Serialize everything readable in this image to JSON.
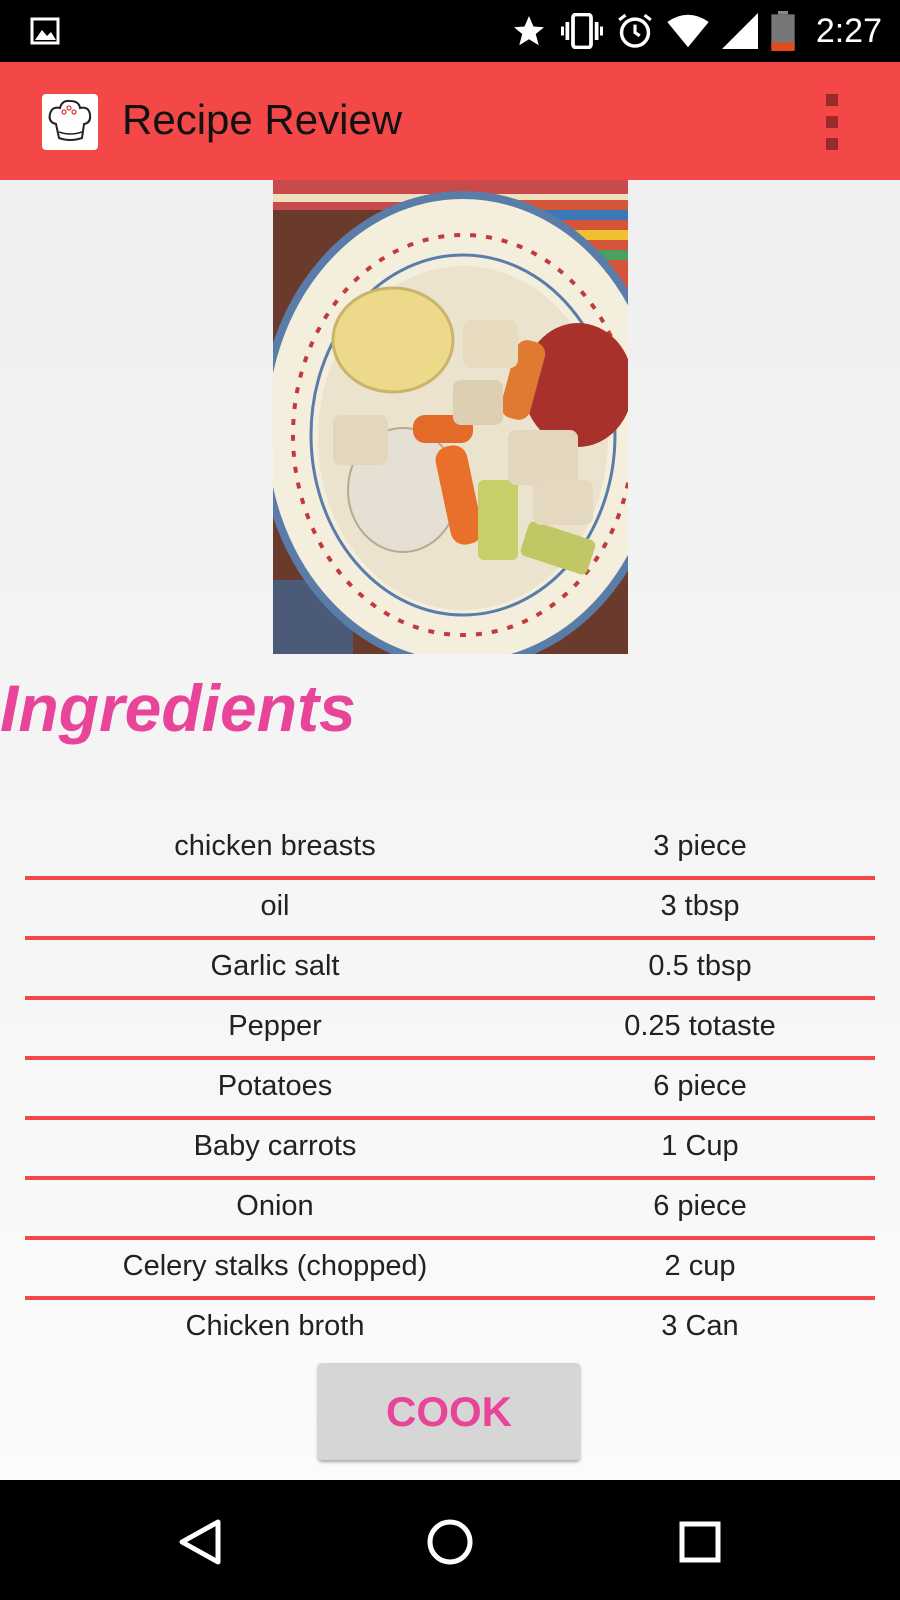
{
  "status_bar": {
    "time": "2:27",
    "icons": [
      "image-notification-icon",
      "star-icon",
      "vibrate-icon",
      "alarm-icon",
      "wifi-icon",
      "cell-signal-icon",
      "battery-low-icon"
    ]
  },
  "app_bar": {
    "title": "Recipe Review",
    "logo_icon": "chef-hat-icon",
    "menu_icon": "overflow-menu-icon"
  },
  "recipe": {
    "image_alt": "chicken stew with potatoes, carrots, onion and celery"
  },
  "ingredients_section": {
    "title": "Ingredients",
    "items": [
      {
        "name": "chicken breasts",
        "quantity": "3 piece"
      },
      {
        "name": "oil",
        "quantity": "3 tbsp"
      },
      {
        "name": "Garlic salt",
        "quantity": "0.5 tbsp"
      },
      {
        "name": "Pepper",
        "quantity": "0.25 totaste"
      },
      {
        "name": "Potatoes",
        "quantity": "6 piece"
      },
      {
        "name": "Baby carrots",
        "quantity": "1 Cup"
      },
      {
        "name": "Onion",
        "quantity": "6 piece"
      },
      {
        "name": "Celery stalks (chopped)",
        "quantity": "2 cup"
      },
      {
        "name": "Chicken broth",
        "quantity": "3 Can"
      }
    ]
  },
  "actions": {
    "cook_label": "COOK"
  },
  "nav_bar": {
    "buttons": [
      "back-icon",
      "home-icon",
      "recents-icon"
    ]
  },
  "colors": {
    "app_bar": "#f44848",
    "accent_pink": "#e8459a",
    "divider_red": "#f44848"
  }
}
